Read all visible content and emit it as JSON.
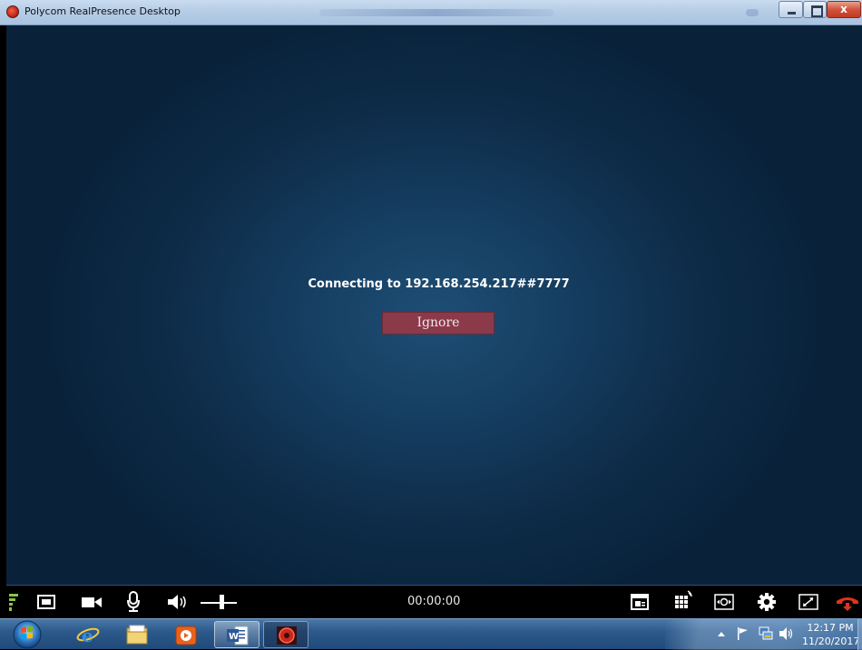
{
  "window": {
    "title": "Polycom RealPresence Desktop",
    "close_glyph": "x"
  },
  "call": {
    "status_text": "Connecting to 192.168.254.217##7777",
    "ignore_label": "Ignore",
    "timer": "00:00:00"
  },
  "controls": {
    "left": [
      "signal-strength-icon",
      "self-view-icon",
      "camera-icon",
      "microphone-icon",
      "speaker-icon",
      "volume-slider"
    ],
    "right": [
      "content-share-icon",
      "keypad-icon",
      "far-end-camera-icon",
      "settings-icon",
      "fullscreen-icon",
      "hang-up-icon"
    ],
    "hangup_color": "#e0321c"
  },
  "taskbar": {
    "apps": [
      "start-orb",
      "internet-explorer-icon",
      "file-explorer-icon",
      "media-player-icon",
      "word-icon",
      "polycom-icon"
    ],
    "tray_icons": [
      "show-hidden-icon",
      "action-center-flag-icon",
      "network-icon",
      "volume-icon"
    ],
    "time": "12:17 PM",
    "date": "11/20/2017"
  }
}
